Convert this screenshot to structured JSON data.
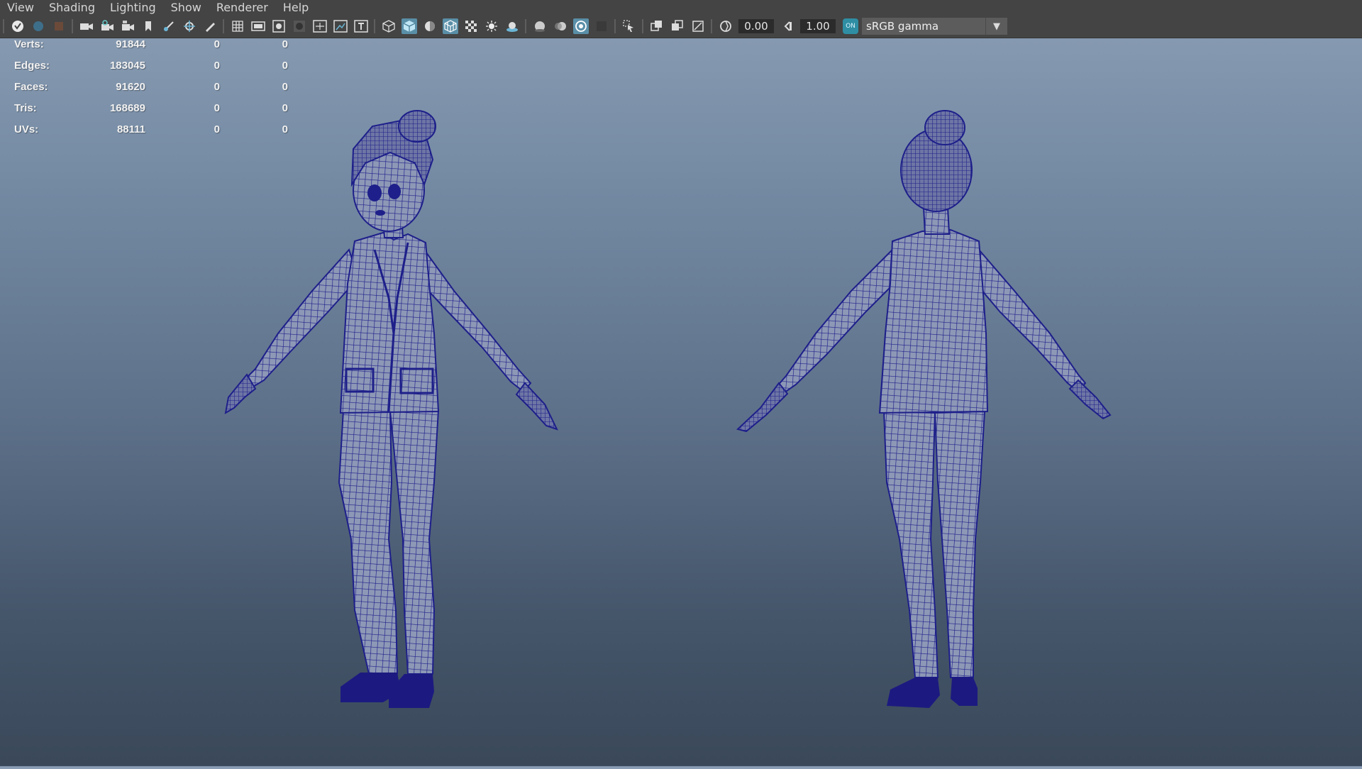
{
  "menu": [
    "View",
    "Shading",
    "Lighting",
    "Show",
    "Renderer",
    "Help"
  ],
  "toolbar": {
    "exposure": "0.00",
    "gamma": "1.00",
    "color_mgmt_badge": "ON",
    "color_space": "sRGB gamma"
  },
  "hud": {
    "rows": [
      {
        "label": "Verts:",
        "v1": "91844",
        "v2": "0",
        "v3": "0"
      },
      {
        "label": "Edges:",
        "v1": "183045",
        "v2": "0",
        "v3": "0"
      },
      {
        "label": "Faces:",
        "v1": "91620",
        "v2": "0",
        "v3": "0"
      },
      {
        "label": "Tris:",
        "v1": "168689",
        "v2": "0",
        "v3": "0"
      },
      {
        "label": "UVs:",
        "v1": "88111",
        "v2": "0",
        "v3": "0"
      }
    ]
  },
  "colors": {
    "wireframe": "#1e1f8a",
    "wire_fill": "#8d98b6",
    "shoe": "#1c1a80",
    "accent": "#5a8fa8"
  }
}
